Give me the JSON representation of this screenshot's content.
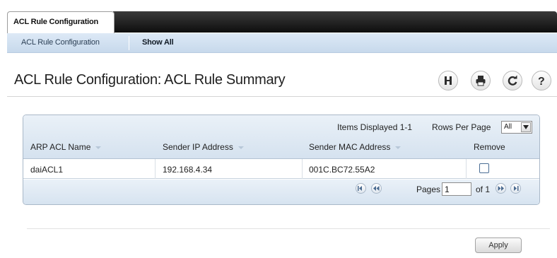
{
  "top_tabs": [
    {
      "label": "ACL Rule Configuration",
      "active": true
    }
  ],
  "sub_nav": {
    "items": [
      {
        "label": "ACL Rule Configuration",
        "active": false
      },
      {
        "label": "Show All",
        "active": true
      }
    ]
  },
  "page": {
    "title": "ACL Rule Configuration: ACL Rule Summary"
  },
  "toolbar": {
    "icons": [
      "save-icon",
      "print-icon",
      "refresh-icon",
      "help-icon"
    ]
  },
  "table": {
    "items_displayed": "Items Displayed 1-1",
    "rows_per_page_label": "Rows Per Page",
    "rows_per_page_value": "All",
    "columns": [
      "ARP ACL Name",
      "Sender IP Address",
      "Sender MAC Address",
      "Remove"
    ],
    "rows": [
      {
        "name": "daiACL1",
        "ip": "192.168.4.34",
        "mac": "001C.BC72.55A2",
        "remove": false
      }
    ],
    "pagination": {
      "pages_label": "Pages",
      "current_page": "1",
      "of_label": "of 1"
    }
  },
  "footer": {
    "apply_label": "Apply"
  },
  "colors": {
    "tab_strip": "#1a1a1a",
    "sub_nav_bg": "#cfdfef",
    "panel_header_bg": "#dfe8f2",
    "checkbox_border": "#4b6e95"
  }
}
